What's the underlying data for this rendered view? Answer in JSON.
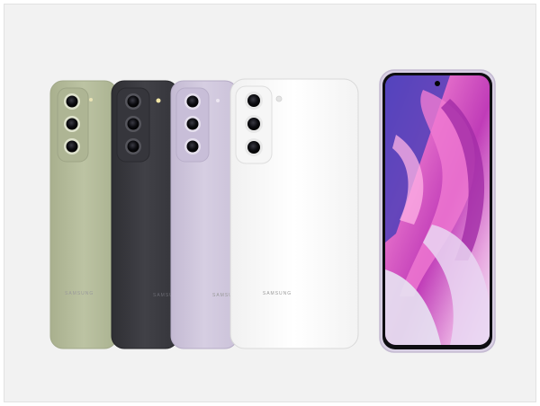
{
  "product": {
    "brand_text": "SAMSUNG"
  },
  "colors": {
    "background": "#f2f2f2",
    "olive": "#b8bf9e",
    "graphite": "#3b3b40",
    "lavender": "#cfc6dc",
    "white": "#fafafa",
    "screen_accent": "#c240b5"
  }
}
